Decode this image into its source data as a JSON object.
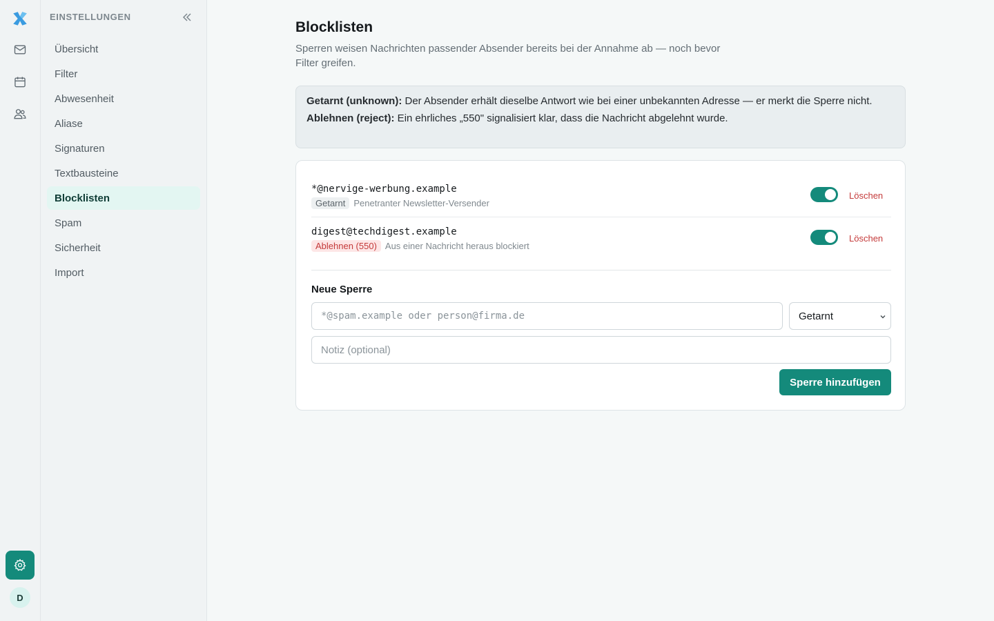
{
  "colors": {
    "accent": "#148a7b",
    "danger": "#c43a3a",
    "active_bg": "#e3f6f2"
  },
  "rail": {
    "icons": [
      "logo-icon",
      "mail-icon",
      "calendar-icon",
      "contacts-icon",
      "settings-icon"
    ],
    "avatar_initial": "D"
  },
  "sidebar": {
    "title": "EINSTELLUNGEN",
    "items": [
      {
        "label": "Übersicht"
      },
      {
        "label": "Filter"
      },
      {
        "label": "Abwesenheit"
      },
      {
        "label": "Aliase"
      },
      {
        "label": "Signaturen"
      },
      {
        "label": "Textbausteine"
      },
      {
        "label": "Blocklisten",
        "active": true
      },
      {
        "label": "Spam"
      },
      {
        "label": "Sicherheit"
      },
      {
        "label": "Import"
      }
    ]
  },
  "page": {
    "title": "Blocklisten",
    "description": "Sperren weisen Nachrichten passender Absender bereits bei der Annahme ab — noch bevor Filter greifen."
  },
  "info": {
    "line1_label": "Getarnt (unknown):",
    "line1_text": " Der Absender erhält dieselbe Antwort wie bei einer unbekannten Adresse — er merkt die Sperre nicht.",
    "line2_label": "Ablehnen (reject):",
    "line2_text": " Ein ehrliches „550\" signalisiert klar, dass die Nachricht abgelehnt wurde."
  },
  "entries": [
    {
      "address": "*@nervige-werbung.example",
      "mode": "Getarnt",
      "note": "Penetranter Newsletter-Versender",
      "enabled": true,
      "delete_label": "Löschen"
    },
    {
      "address": "digest@techdigest.example",
      "mode": "Ablehnen (550)",
      "note": "Aus einer Nachricht heraus blockiert",
      "enabled": true,
      "delete_label": "Löschen"
    }
  ],
  "new_block": {
    "title": "Neue Sperre",
    "address_placeholder": "*@spam.example oder person@firma.de",
    "note_placeholder": "Notiz (optional)",
    "mode_selected": "Getarnt",
    "submit_label": "Sperre hinzufügen"
  }
}
